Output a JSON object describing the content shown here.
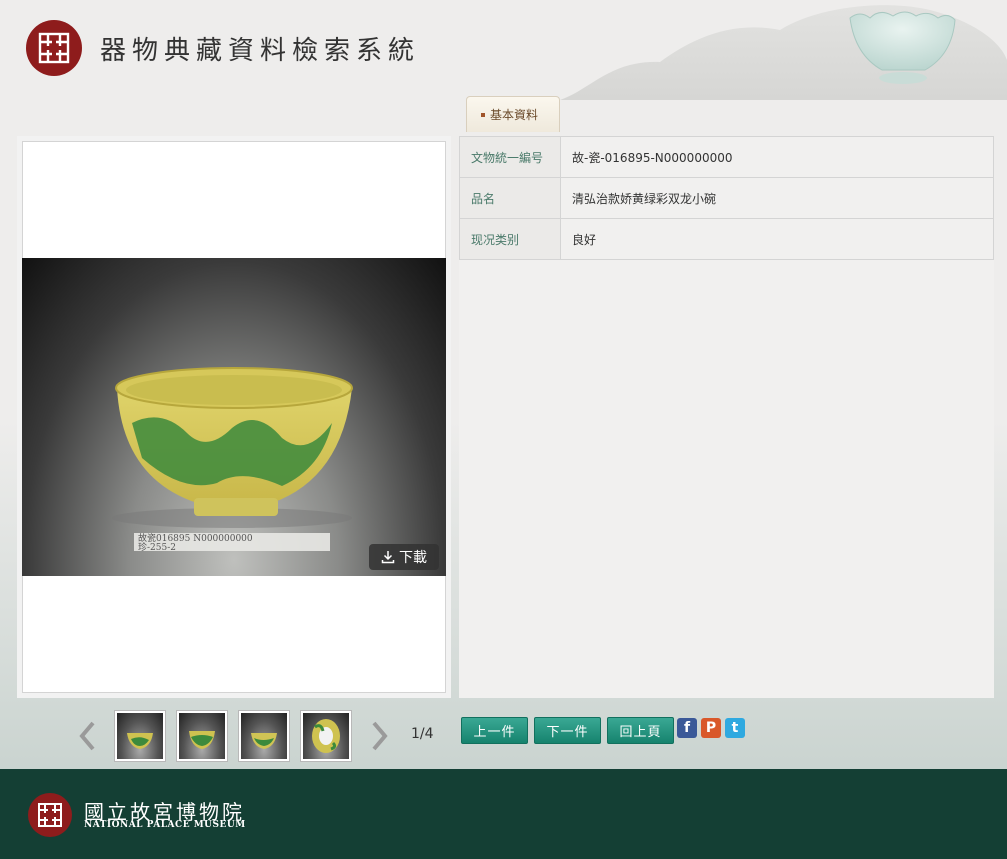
{
  "header": {
    "site_title": "器物典藏資料檢索系統"
  },
  "tab": {
    "label": "基本資料"
  },
  "image_panel": {
    "download_label": "下載",
    "photo_caption_lines": [
      "故瓷016895 N000000000",
      "珍-255-2"
    ]
  },
  "info": {
    "rows": [
      {
        "key": "文物統一編号",
        "value": "故-瓷-016895-N000000000"
      },
      {
        "key": "品名",
        "value": "清弘治款娇黄绿彩双龙小碗"
      },
      {
        "key": "现况类别",
        "value": "良好"
      }
    ]
  },
  "pager": {
    "counter": "1/4"
  },
  "actions": {
    "prev_label": "上一件",
    "next_label": "下一件",
    "back_label": "回上頁"
  },
  "social": {
    "facebook": "f",
    "plurk": "P",
    "twitter": "t"
  },
  "footer": {
    "name_zh": "國立故宮博物院",
    "name_en": "NATIONAL PALACE MUSEUM"
  },
  "colors": {
    "brand_red": "#8e1c1c",
    "accent_green": "#16836e",
    "footer_bg": "#143f34"
  }
}
